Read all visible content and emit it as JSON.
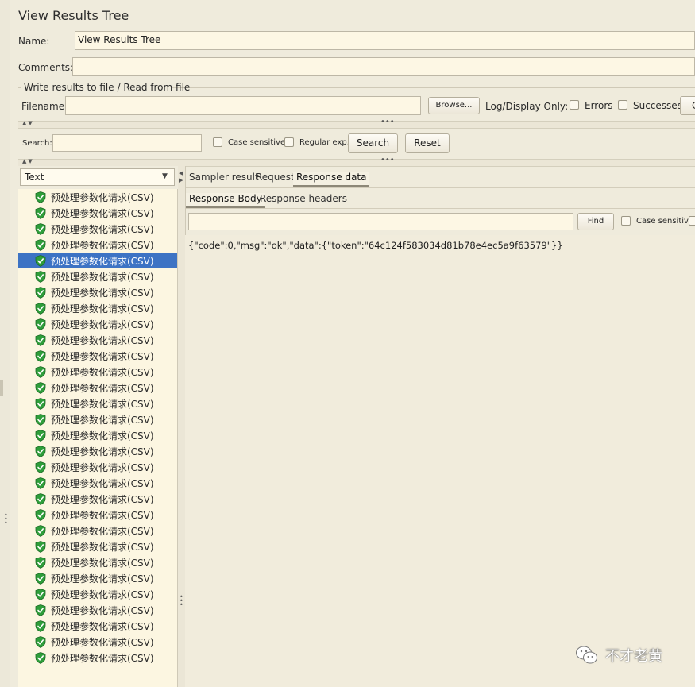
{
  "window": {
    "title": "View Results Tree"
  },
  "form": {
    "name_label": "Name:",
    "name_value": "View Results Tree",
    "comments_label": "Comments:",
    "comments_value": "",
    "file_group_title": "Write results to file / Read from file",
    "filename_label": "Filename",
    "filename_value": "",
    "browse_label": "Browse...",
    "log_display_label": "Log/Display Only:",
    "errors_label": "Errors",
    "successes_label": "Successes",
    "configure_label": "C"
  },
  "search": {
    "label": "Search:",
    "value": "",
    "case_sensitive_label": "Case sensitive",
    "regex_label": "Regular exp.",
    "search_button": "Search",
    "reset_button": "Reset"
  },
  "tree": {
    "renderer_selected": "Text",
    "items": [
      {
        "label": "预处理参数化请求(CSV)",
        "selected": false
      },
      {
        "label": "预处理参数化请求(CSV)",
        "selected": false
      },
      {
        "label": "预处理参数化请求(CSV)",
        "selected": false
      },
      {
        "label": "预处理参数化请求(CSV)",
        "selected": false
      },
      {
        "label": "预处理参数化请求(CSV)",
        "selected": true
      },
      {
        "label": "预处理参数化请求(CSV)",
        "selected": false
      },
      {
        "label": "预处理参数化请求(CSV)",
        "selected": false
      },
      {
        "label": "预处理参数化请求(CSV)",
        "selected": false
      },
      {
        "label": "预处理参数化请求(CSV)",
        "selected": false
      },
      {
        "label": "预处理参数化请求(CSV)",
        "selected": false
      },
      {
        "label": "预处理参数化请求(CSV)",
        "selected": false
      },
      {
        "label": "预处理参数化请求(CSV)",
        "selected": false
      },
      {
        "label": "预处理参数化请求(CSV)",
        "selected": false
      },
      {
        "label": "预处理参数化请求(CSV)",
        "selected": false
      },
      {
        "label": "预处理参数化请求(CSV)",
        "selected": false
      },
      {
        "label": "预处理参数化请求(CSV)",
        "selected": false
      },
      {
        "label": "预处理参数化请求(CSV)",
        "selected": false
      },
      {
        "label": "预处理参数化请求(CSV)",
        "selected": false
      },
      {
        "label": "预处理参数化请求(CSV)",
        "selected": false
      },
      {
        "label": "预处理参数化请求(CSV)",
        "selected": false
      },
      {
        "label": "预处理参数化请求(CSV)",
        "selected": false
      },
      {
        "label": "预处理参数化请求(CSV)",
        "selected": false
      },
      {
        "label": "预处理参数化请求(CSV)",
        "selected": false
      },
      {
        "label": "预处理参数化请求(CSV)",
        "selected": false
      },
      {
        "label": "预处理参数化请求(CSV)",
        "selected": false
      },
      {
        "label": "预处理参数化请求(CSV)",
        "selected": false
      },
      {
        "label": "预处理参数化请求(CSV)",
        "selected": false
      },
      {
        "label": "预处理参数化请求(CSV)",
        "selected": false
      },
      {
        "label": "预处理参数化请求(CSV)",
        "selected": false
      },
      {
        "label": "预处理参数化请求(CSV)",
        "selected": false
      }
    ]
  },
  "result_tabs": [
    "Sampler result",
    "Request",
    "Response data"
  ],
  "response_tabs": [
    "Response Body",
    "Response headers"
  ],
  "find": {
    "value": "",
    "find_button": "Find",
    "case_sensitive_label": "Case sensitive"
  },
  "response_body": "{\"code\":0,\"msg\":\"ok\",\"data\":{\"token\":\"64c124f583034d81b78e4ec5a9f63579\"}}",
  "watermark": {
    "text": "不才老黄"
  },
  "colors": {
    "selection": "#3d73c4",
    "success_icon": "#2e9e3a",
    "field_bg": "#fdf7e4"
  }
}
